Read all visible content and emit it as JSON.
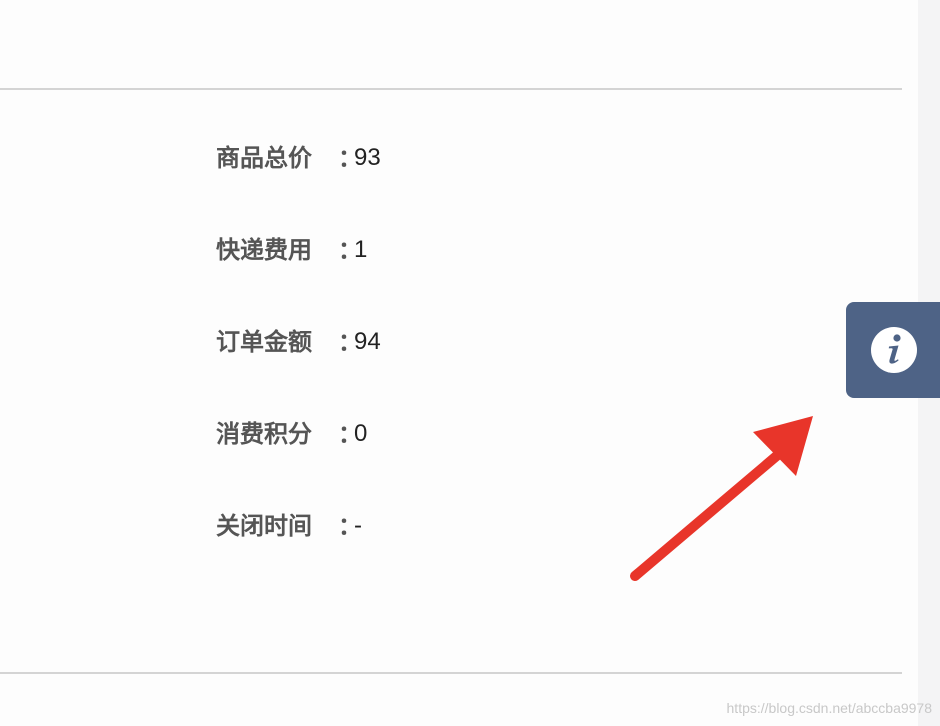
{
  "order_info": {
    "rows": [
      {
        "label": "商品总价",
        "colon": "：",
        "value": "93"
      },
      {
        "label": "快递费用",
        "colon": "：",
        "value": "1"
      },
      {
        "label": "订单金额",
        "colon": "：",
        "value": "94"
      },
      {
        "label": "消费积分",
        "colon": "：",
        "value": "0"
      },
      {
        "label": "关闭时间",
        "colon": "：",
        "value": "-"
      }
    ]
  },
  "info_tab": {
    "icon": "info-icon",
    "color": "#4e6386"
  },
  "annotation": {
    "arrow_color": "#e8352a",
    "points_to": "info-tab"
  },
  "watermark": "https://blog.csdn.net/abccba9978"
}
